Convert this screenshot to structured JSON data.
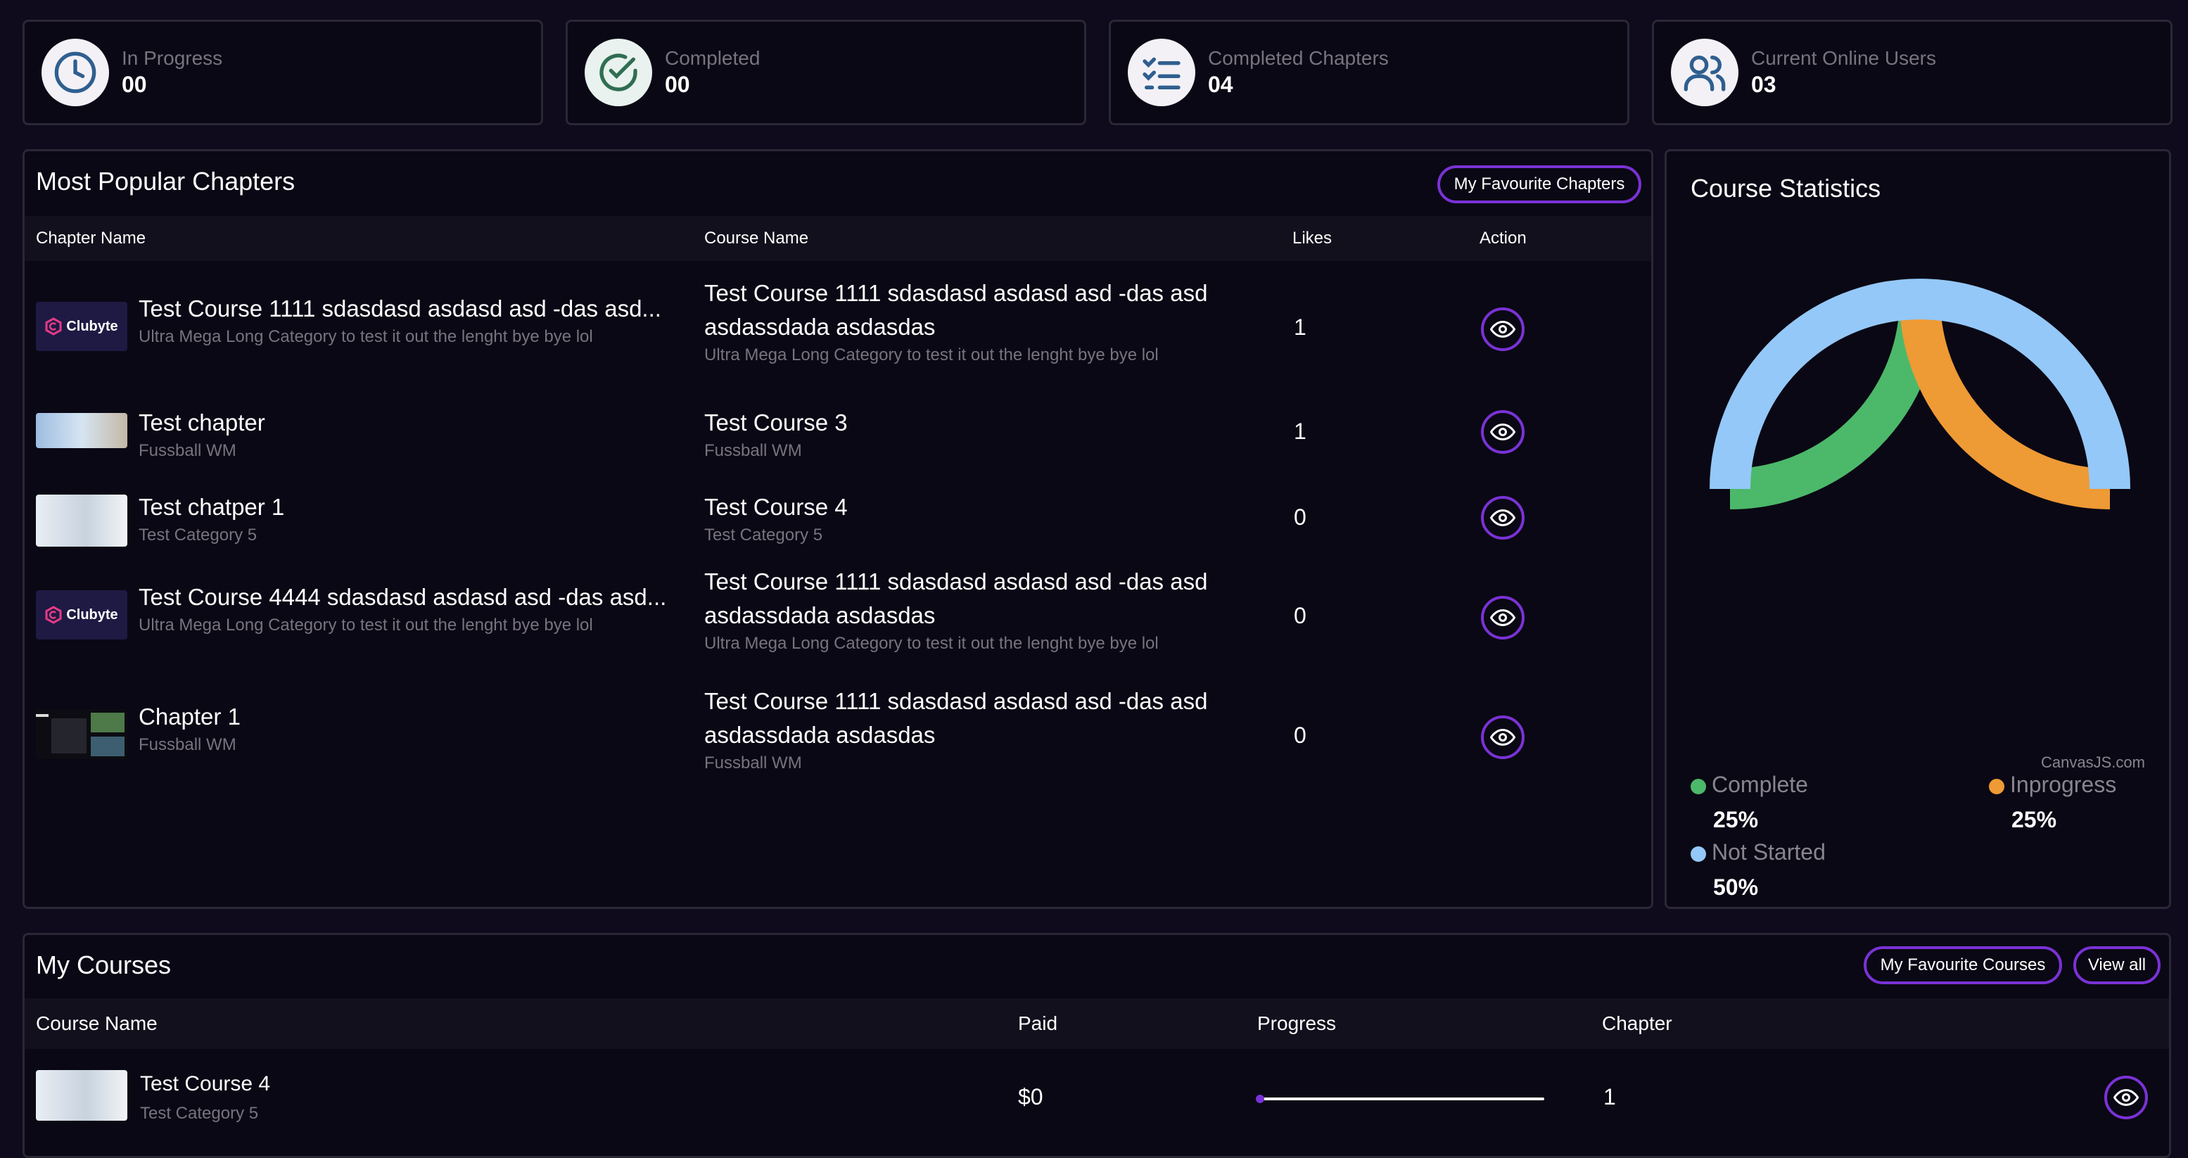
{
  "stats": [
    {
      "label": "In Progress",
      "value": "00",
      "icon": "clock-icon"
    },
    {
      "label": "Completed",
      "value": "00",
      "icon": "check-circle-icon"
    },
    {
      "label": "Completed Chapters",
      "value": "04",
      "icon": "checklist-icon"
    },
    {
      "label": "Current Online Users",
      "value": "03",
      "icon": "users-icon"
    }
  ],
  "popular": {
    "title": "Most Popular Chapters",
    "fav_button": "My Favourite Chapters",
    "columns": {
      "chapter": "Chapter Name",
      "course": "Course Name",
      "likes": "Likes",
      "action": "Action"
    },
    "rows": [
      {
        "chapter": "Test Course 1111 sdasdasd asdasd asd -das asd...",
        "chapter_cat": "Ultra Mega Long Category to test it out the lenght bye bye lol",
        "course_l1": "Test Course 1111 sdasdasd asdasd asd -das asd",
        "course_l2": "asdassdada asdasdas",
        "course_cat": "Ultra Mega Long Category to test it out the lenght bye bye lol",
        "likes": "1",
        "thumb": "clubyte-logo"
      },
      {
        "chapter": "Test chapter",
        "chapter_cat": "Fussball WM",
        "course_l1": "Test Course 3",
        "course_l2": "",
        "course_cat": "Fussball WM",
        "likes": "1",
        "thumb": "photo"
      },
      {
        "chapter": "Test chatper 1",
        "chapter_cat": "Test Category 5",
        "course_l1": "Test Course 4",
        "course_l2": "",
        "course_cat": "Test Category 5",
        "likes": "0",
        "thumb": "photo"
      },
      {
        "chapter": "Test Course 4444 sdasdasd asdasd asd -das asd...",
        "chapter_cat": "Ultra Mega Long Category to test it out the lenght bye bye lol",
        "course_l1": "Test Course 1111 sdasdasd asdasd asd -das asd",
        "course_l2": "asdassdada asdasdas",
        "course_cat": "Ultra Mega Long Category to test it out the lenght bye bye lol",
        "likes": "0",
        "thumb": "clubyte-logo"
      },
      {
        "chapter": "Chapter 1",
        "chapter_cat": "Fussball WM",
        "course_l1": "Test Course 1111 sdasdasd asdasd asd -das asd",
        "course_l2": "asdassdada asdasdas",
        "course_cat": "Fussball WM",
        "likes": "0",
        "thumb": "screenshot"
      }
    ],
    "logo_text": "Clubyte"
  },
  "statistics": {
    "title": "Course Statistics",
    "credit": "CanvasJS.com",
    "legend": [
      {
        "label": "Complete",
        "value": "25%",
        "color": "#4cb86a"
      },
      {
        "label": "Inprogress",
        "value": "25%",
        "color": "#ee9a35"
      },
      {
        "label": "Not Started",
        "value": "50%",
        "color": "#94c8f8"
      }
    ]
  },
  "chart_data": {
    "type": "pie",
    "variant": "doughnut",
    "title": "Course Statistics",
    "categories": [
      "Complete",
      "Inprogress",
      "Not Started"
    ],
    "values": [
      25,
      25,
      50
    ],
    "colors": [
      "#4cb86a",
      "#ee9a35",
      "#94c8f8"
    ]
  },
  "my_courses": {
    "title": "My Courses",
    "fav_button": "My Favourite Courses",
    "view_all": "View all",
    "columns": {
      "course": "Course Name",
      "paid": "Paid",
      "progress": "Progress",
      "chapter": "Chapter"
    },
    "rows": [
      {
        "name": "Test Course 4",
        "category": "Test Category 5",
        "paid": "$0",
        "progress": 0,
        "chapter": "1"
      }
    ]
  },
  "colors": {
    "accent": "#7a32d6",
    "bg": "#0f0a1c",
    "card": "#0a0814",
    "muted": "#77737f"
  }
}
